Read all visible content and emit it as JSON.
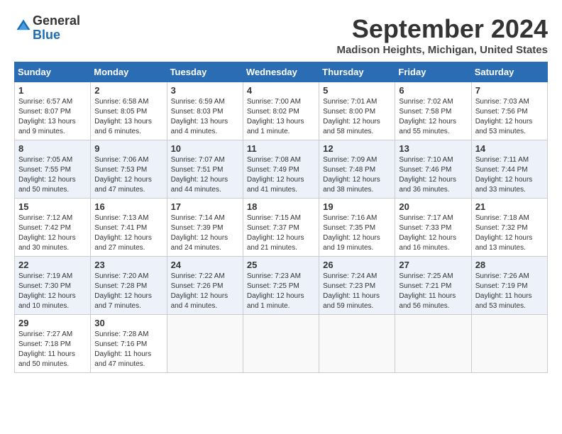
{
  "header": {
    "logo_line1": "General",
    "logo_line2": "Blue",
    "month": "September 2024",
    "location": "Madison Heights, Michigan, United States"
  },
  "weekdays": [
    "Sunday",
    "Monday",
    "Tuesday",
    "Wednesday",
    "Thursday",
    "Friday",
    "Saturday"
  ],
  "weeks": [
    [
      {
        "day": "1",
        "info": "Sunrise: 6:57 AM\nSunset: 8:07 PM\nDaylight: 13 hours\nand 9 minutes."
      },
      {
        "day": "2",
        "info": "Sunrise: 6:58 AM\nSunset: 8:05 PM\nDaylight: 13 hours\nand 6 minutes."
      },
      {
        "day": "3",
        "info": "Sunrise: 6:59 AM\nSunset: 8:03 PM\nDaylight: 13 hours\nand 4 minutes."
      },
      {
        "day": "4",
        "info": "Sunrise: 7:00 AM\nSunset: 8:02 PM\nDaylight: 13 hours\nand 1 minute."
      },
      {
        "day": "5",
        "info": "Sunrise: 7:01 AM\nSunset: 8:00 PM\nDaylight: 12 hours\nand 58 minutes."
      },
      {
        "day": "6",
        "info": "Sunrise: 7:02 AM\nSunset: 7:58 PM\nDaylight: 12 hours\nand 55 minutes."
      },
      {
        "day": "7",
        "info": "Sunrise: 7:03 AM\nSunset: 7:56 PM\nDaylight: 12 hours\nand 53 minutes."
      }
    ],
    [
      {
        "day": "8",
        "info": "Sunrise: 7:05 AM\nSunset: 7:55 PM\nDaylight: 12 hours\nand 50 minutes."
      },
      {
        "day": "9",
        "info": "Sunrise: 7:06 AM\nSunset: 7:53 PM\nDaylight: 12 hours\nand 47 minutes."
      },
      {
        "day": "10",
        "info": "Sunrise: 7:07 AM\nSunset: 7:51 PM\nDaylight: 12 hours\nand 44 minutes."
      },
      {
        "day": "11",
        "info": "Sunrise: 7:08 AM\nSunset: 7:49 PM\nDaylight: 12 hours\nand 41 minutes."
      },
      {
        "day": "12",
        "info": "Sunrise: 7:09 AM\nSunset: 7:48 PM\nDaylight: 12 hours\nand 38 minutes."
      },
      {
        "day": "13",
        "info": "Sunrise: 7:10 AM\nSunset: 7:46 PM\nDaylight: 12 hours\nand 36 minutes."
      },
      {
        "day": "14",
        "info": "Sunrise: 7:11 AM\nSunset: 7:44 PM\nDaylight: 12 hours\nand 33 minutes."
      }
    ],
    [
      {
        "day": "15",
        "info": "Sunrise: 7:12 AM\nSunset: 7:42 PM\nDaylight: 12 hours\nand 30 minutes."
      },
      {
        "day": "16",
        "info": "Sunrise: 7:13 AM\nSunset: 7:41 PM\nDaylight: 12 hours\nand 27 minutes."
      },
      {
        "day": "17",
        "info": "Sunrise: 7:14 AM\nSunset: 7:39 PM\nDaylight: 12 hours\nand 24 minutes."
      },
      {
        "day": "18",
        "info": "Sunrise: 7:15 AM\nSunset: 7:37 PM\nDaylight: 12 hours\nand 21 minutes."
      },
      {
        "day": "19",
        "info": "Sunrise: 7:16 AM\nSunset: 7:35 PM\nDaylight: 12 hours\nand 19 minutes."
      },
      {
        "day": "20",
        "info": "Sunrise: 7:17 AM\nSunset: 7:33 PM\nDaylight: 12 hours\nand 16 minutes."
      },
      {
        "day": "21",
        "info": "Sunrise: 7:18 AM\nSunset: 7:32 PM\nDaylight: 12 hours\nand 13 minutes."
      }
    ],
    [
      {
        "day": "22",
        "info": "Sunrise: 7:19 AM\nSunset: 7:30 PM\nDaylight: 12 hours\nand 10 minutes."
      },
      {
        "day": "23",
        "info": "Sunrise: 7:20 AM\nSunset: 7:28 PM\nDaylight: 12 hours\nand 7 minutes."
      },
      {
        "day": "24",
        "info": "Sunrise: 7:22 AM\nSunset: 7:26 PM\nDaylight: 12 hours\nand 4 minutes."
      },
      {
        "day": "25",
        "info": "Sunrise: 7:23 AM\nSunset: 7:25 PM\nDaylight: 12 hours\nand 1 minute."
      },
      {
        "day": "26",
        "info": "Sunrise: 7:24 AM\nSunset: 7:23 PM\nDaylight: 11 hours\nand 59 minutes."
      },
      {
        "day": "27",
        "info": "Sunrise: 7:25 AM\nSunset: 7:21 PM\nDaylight: 11 hours\nand 56 minutes."
      },
      {
        "day": "28",
        "info": "Sunrise: 7:26 AM\nSunset: 7:19 PM\nDaylight: 11 hours\nand 53 minutes."
      }
    ],
    [
      {
        "day": "29",
        "info": "Sunrise: 7:27 AM\nSunset: 7:18 PM\nDaylight: 11 hours\nand 50 minutes."
      },
      {
        "day": "30",
        "info": "Sunrise: 7:28 AM\nSunset: 7:16 PM\nDaylight: 11 hours\nand 47 minutes."
      },
      {
        "day": "",
        "info": ""
      },
      {
        "day": "",
        "info": ""
      },
      {
        "day": "",
        "info": ""
      },
      {
        "day": "",
        "info": ""
      },
      {
        "day": "",
        "info": ""
      }
    ]
  ]
}
